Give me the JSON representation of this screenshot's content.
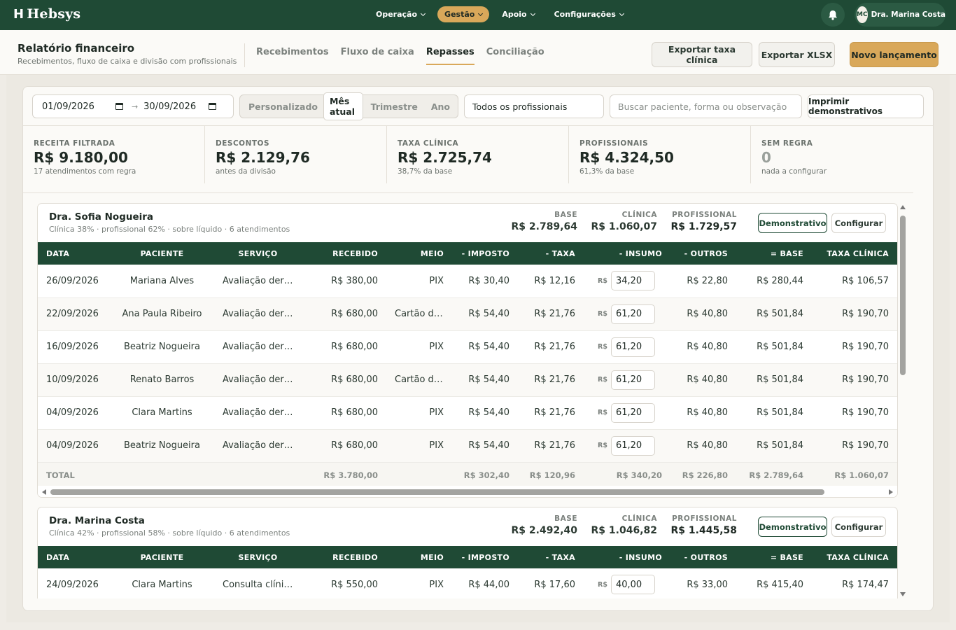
{
  "app": {
    "name": "Hebsys"
  },
  "nav": {
    "items": [
      {
        "label": "Operação",
        "active": false
      },
      {
        "label": "Gestão",
        "active": true
      },
      {
        "label": "Apoio",
        "active": false
      },
      {
        "label": "Configurações",
        "active": false
      }
    ],
    "user": {
      "initials": "MC",
      "name": "Dra. Marina Costa"
    },
    "icons": {
      "notifications": "bell-icon"
    }
  },
  "header": {
    "title": "Relatório financeiro",
    "subtitle": "Recebimentos, fluxo de caixa e divisão com profissionais",
    "tabs": [
      {
        "label": "Recebimentos",
        "active": false
      },
      {
        "label": "Fluxo de caixa",
        "active": false
      },
      {
        "label": "Repasses",
        "active": true
      },
      {
        "label": "Conciliação",
        "active": false
      }
    ],
    "buttons": {
      "export_fee": "Exportar taxa clínica",
      "export_xlsx": "Exportar XLSX",
      "new_entry": "Novo lançamento"
    }
  },
  "filters": {
    "date_from": "01/09/2026",
    "date_sep": "→",
    "date_to": "30/09/2026",
    "periods": [
      {
        "label": "Personalizado",
        "active": false
      },
      {
        "label": "Mês atual",
        "active": true
      },
      {
        "label": "Trimestre",
        "active": false
      },
      {
        "label": "Ano",
        "active": false
      }
    ],
    "professional_select": "Todos os profissionais",
    "search_placeholder": "Buscar paciente, forma ou observação",
    "print_button": "Imprimir demonstrativos"
  },
  "kpis": [
    {
      "label": "RECEITA FILTRADA",
      "value": "R$ 9.180,00",
      "sub": "17 atendimentos com regra"
    },
    {
      "label": "DESCONTOS",
      "value": "R$ 2.129,76",
      "sub": "antes da divisão"
    },
    {
      "label": "TAXA CLÍNICA",
      "value": "R$ 2.725,74",
      "sub": "38,7% da base"
    },
    {
      "label": "PROFISSIONAIS",
      "value": "R$ 4.324,50",
      "sub": "61,3% da base"
    },
    {
      "label": "SEM REGRA",
      "value": "0",
      "sub": "nada a configurar"
    }
  ],
  "table_headers": [
    "DATA",
    "PACIENTE",
    "SERVIÇO",
    "RECEBIDO",
    "MEIO",
    "- IMPOSTO",
    "- TAXA",
    "- INSUMO",
    "- OUTROS",
    "= BASE",
    "TAXA CLÍNICA"
  ],
  "currency_prefix": "R$",
  "group_labels": {
    "base": "BASE",
    "clinic": "CLÍNICA",
    "professional": "PROFISSIONAL",
    "statement": "Demonstrativo",
    "configure": "Configurar",
    "total": "TOTAL"
  },
  "groups": [
    {
      "name": "Dra. Sofia Nogueira",
      "subtitle": "Clínica 38% · profissional 62% · sobre líquido · 6 atendimentos",
      "base": "R$ 2.789,64",
      "clinic": "R$ 1.060,07",
      "professional": "R$ 1.729,57",
      "rows": [
        [
          "26/09/2026",
          "Mariana Alves",
          "Avaliação dermat...",
          "R$ 380,00",
          "PIX",
          "R$ 30,40",
          "R$ 12,16",
          "34,20",
          "R$ 22,80",
          "R$ 280,44",
          "R$ 106,57"
        ],
        [
          "22/09/2026",
          "Ana Paula Ribeiro",
          "Avaliação dermat...",
          "R$ 680,00",
          "Cartão de ...",
          "R$ 54,40",
          "R$ 21,76",
          "61,20",
          "R$ 40,80",
          "R$ 501,84",
          "R$ 190,70"
        ],
        [
          "16/09/2026",
          "Beatriz Nogueira",
          "Avaliação dermat...",
          "R$ 680,00",
          "PIX",
          "R$ 54,40",
          "R$ 21,76",
          "61,20",
          "R$ 40,80",
          "R$ 501,84",
          "R$ 190,70"
        ],
        [
          "10/09/2026",
          "Renato Barros",
          "Avaliação dermat...",
          "R$ 680,00",
          "Cartão de ...",
          "R$ 54,40",
          "R$ 21,76",
          "61,20",
          "R$ 40,80",
          "R$ 501,84",
          "R$ 190,70"
        ],
        [
          "04/09/2026",
          "Clara Martins",
          "Avaliação dermat...",
          "R$ 680,00",
          "PIX",
          "R$ 54,40",
          "R$ 21,76",
          "61,20",
          "R$ 40,80",
          "R$ 501,84",
          "R$ 190,70"
        ],
        [
          "04/09/2026",
          "Beatriz Nogueira",
          "Avaliação dermat...",
          "R$ 680,00",
          "PIX",
          "R$ 54,40",
          "R$ 21,76",
          "61,20",
          "R$ 40,80",
          "R$ 501,84",
          "R$ 190,70"
        ]
      ],
      "totals": [
        "R$ 3.780,00",
        "R$ 302,40",
        "R$ 120,96",
        "R$ 340,20",
        "R$ 226,80",
        "R$ 2.789,64",
        "R$ 1.060,07"
      ]
    },
    {
      "name": "Dra. Marina Costa",
      "subtitle": "Clínica 42% · profissional 58% · sobre líquido · 6 atendimentos",
      "base": "R$ 2.492,40",
      "clinic": "R$ 1.046,82",
      "professional": "R$ 1.445,58",
      "rows": [
        [
          "24/09/2026",
          "Clara Martins",
          "Consulta clínica",
          "R$ 550,00",
          "PIX",
          "R$ 44,00",
          "R$ 17,60",
          "40,00",
          "R$ 33,00",
          "R$ 415,40",
          "R$ 174,47"
        ]
      ],
      "totals": []
    }
  ],
  "colors": {
    "primary": "#1f4a35",
    "accent": "#d9a85a",
    "background": "#efece6"
  }
}
